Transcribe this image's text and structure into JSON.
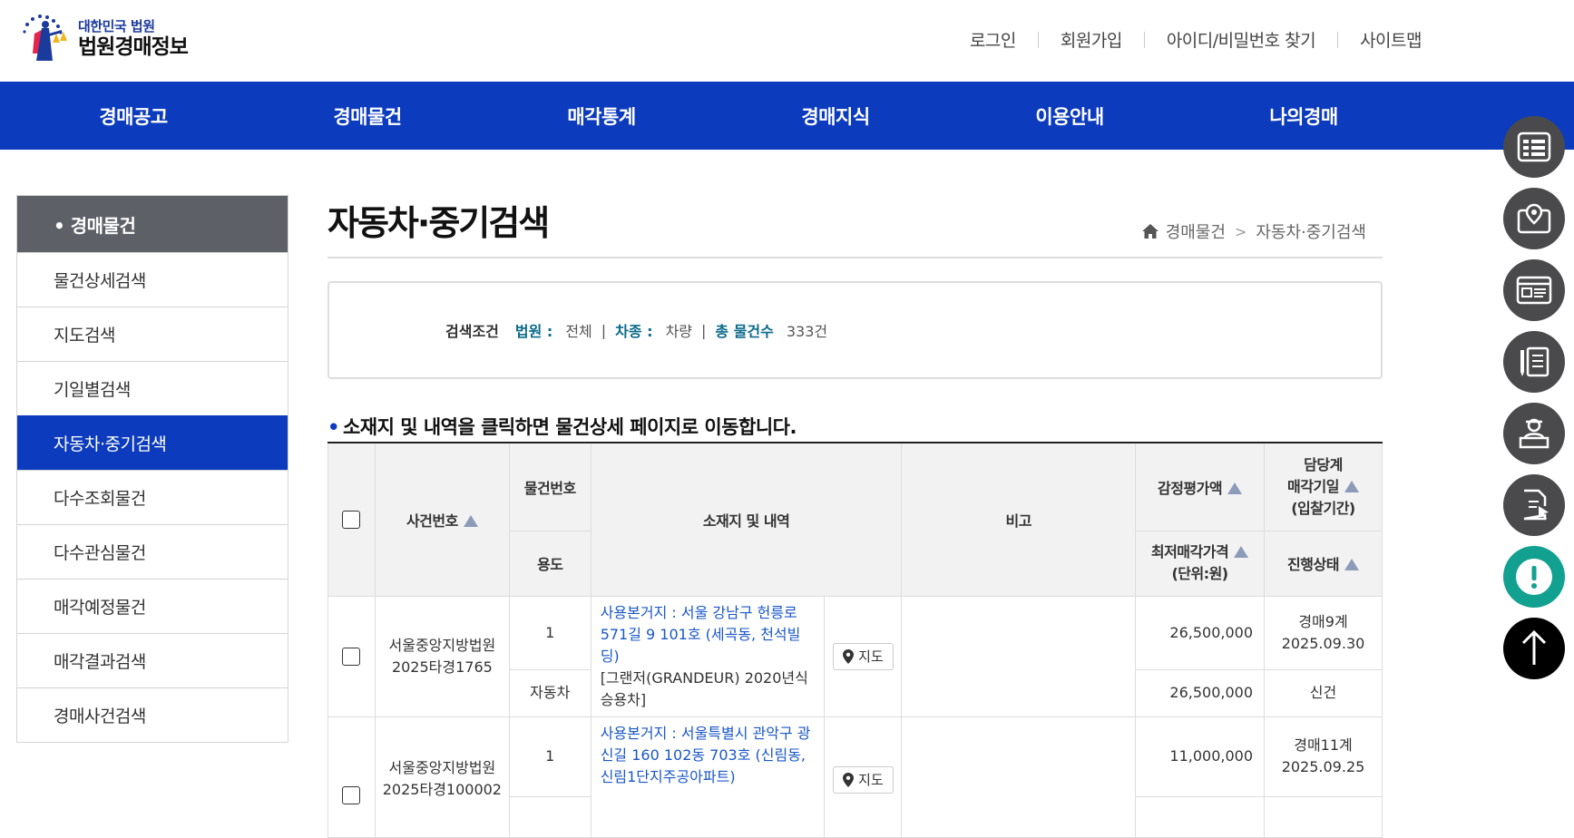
{
  "header": {
    "logo_sub": "대한민국 법원",
    "logo_main": "법원경매정보",
    "util_links": [
      "로그인",
      "회원가입",
      "아이디/비밀번호 찾기",
      "사이트맵"
    ]
  },
  "gnb": [
    "경매공고",
    "경매물건",
    "매각통계",
    "경매지식",
    "이용안내",
    "나의경매"
  ],
  "lnb": {
    "title": "• 경매물건",
    "items": [
      "물건상세검색",
      "지도검색",
      "기일별검색",
      "자동차·중기검색",
      "다수조회물건",
      "다수관심물건",
      "매각예정물건",
      "매각결과검색",
      "경매사건검색"
    ],
    "active_index": 3
  },
  "page": {
    "title": "자동차·중기검색",
    "breadcrumb": [
      "경매물건",
      "자동차·중기검색"
    ]
  },
  "search": {
    "label": "검색조건",
    "court_key": "법원 :",
    "court_val": "전체",
    "type_key": "차종 :",
    "type_val": "차량",
    "total_key": "총 물건수",
    "total_val": "333건"
  },
  "notice": "소재지 및 내역을 클릭하면 물건상세 페이지로 이동합니다.",
  "table": {
    "headers": {
      "case_no": "사건번호",
      "item_no": "물건번호",
      "usage": "용도",
      "location": "소재지 및 내역",
      "note": "비고",
      "appraisal": "감정평가액",
      "min_price": "최저매각가격",
      "unit": "(단위:원)",
      "dept": "담당계",
      "sale_date": "매각기일",
      "bid_period": "(입찰기간)",
      "status": "진행상태"
    },
    "map_label": "지도",
    "rows": [
      {
        "court": "서울중앙지방법원",
        "case": "2025타경1765",
        "item_no": "1",
        "usage": "자동차",
        "addr": "사용본거지 : 서울 강남구 헌릉로571길 9 101호 (세곡동, 천석빌딩)",
        "desc": "[그랜저(GRANDEUR) 2020년식 승용차]",
        "appraisal": "26,500,000",
        "min_price": "26,500,000",
        "dept": "경매9계",
        "date": "2025.09.30",
        "status": "신건"
      },
      {
        "court": "서울중앙지방법원",
        "case": "2025타경100002",
        "item_no": "1",
        "usage": "",
        "addr": "사용본거지 : 서울특별시 관악구 광신길 160 102동 703호 (신림동,신림1단지주공아파트)",
        "desc": "",
        "appraisal": "11,000,000",
        "min_price": "",
        "dept": "경매11계",
        "date": "2025.09.25",
        "status": ""
      }
    ]
  },
  "quick_menu": [
    "list-icon",
    "map-pin-icon",
    "screen-icon",
    "document-pen-icon",
    "clerk-icon",
    "file-cursor-icon",
    "alert-icon",
    "arrow-up-icon"
  ]
}
